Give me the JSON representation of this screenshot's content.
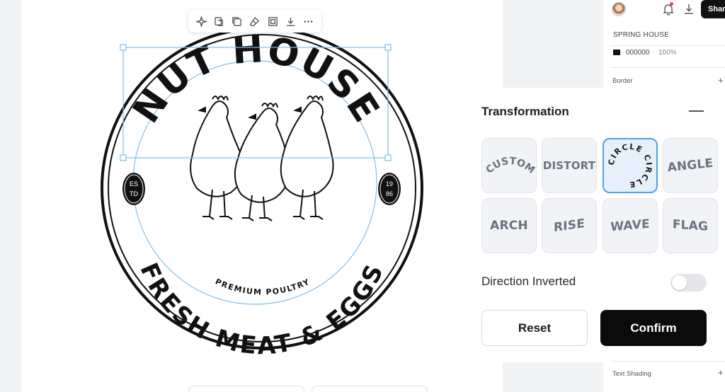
{
  "canvas": {
    "logo": {
      "top_text": "NUT HOUSE",
      "bottom_text": "FRESH MEAT & EGGS",
      "subtitle": "PREMIUM POULTRY",
      "left_badge": [
        "ES",
        "TD"
      ],
      "right_badge": [
        "19",
        "86"
      ]
    },
    "toolbar": {
      "icons": [
        "sparkle-icon",
        "layers-icon",
        "duplicate-icon",
        "eraser-icon",
        "crop-icon",
        "download-icon",
        "more-icon"
      ]
    }
  },
  "header": {
    "share_label": "Share"
  },
  "layers_panel": {
    "font_name": "SPRING HOUSE",
    "color_hex": "000000",
    "opacity": "100%",
    "border_label": "Border",
    "text_shading_label": "Text Shading"
  },
  "transformation": {
    "title": "Transformation",
    "options": [
      {
        "label": "CUSTOM",
        "selected": false
      },
      {
        "label": "DISTORT",
        "selected": false
      },
      {
        "label": "CIRCLE CIRCLE",
        "selected": true
      },
      {
        "label": "ANGLE",
        "selected": false
      },
      {
        "label": "ARCH",
        "selected": false
      },
      {
        "label": "RISE",
        "selected": false
      },
      {
        "label": "WAVE",
        "selected": false
      },
      {
        "label": "FLAG",
        "selected": false
      }
    ],
    "direction_inverted_label": "Direction Inverted",
    "direction_inverted": false,
    "reset_label": "Reset",
    "confirm_label": "Confirm"
  },
  "colors": {
    "accent": "#4aa3e8",
    "primary_button": "#0b0b0c",
    "notification_dot": "#ef4444"
  }
}
